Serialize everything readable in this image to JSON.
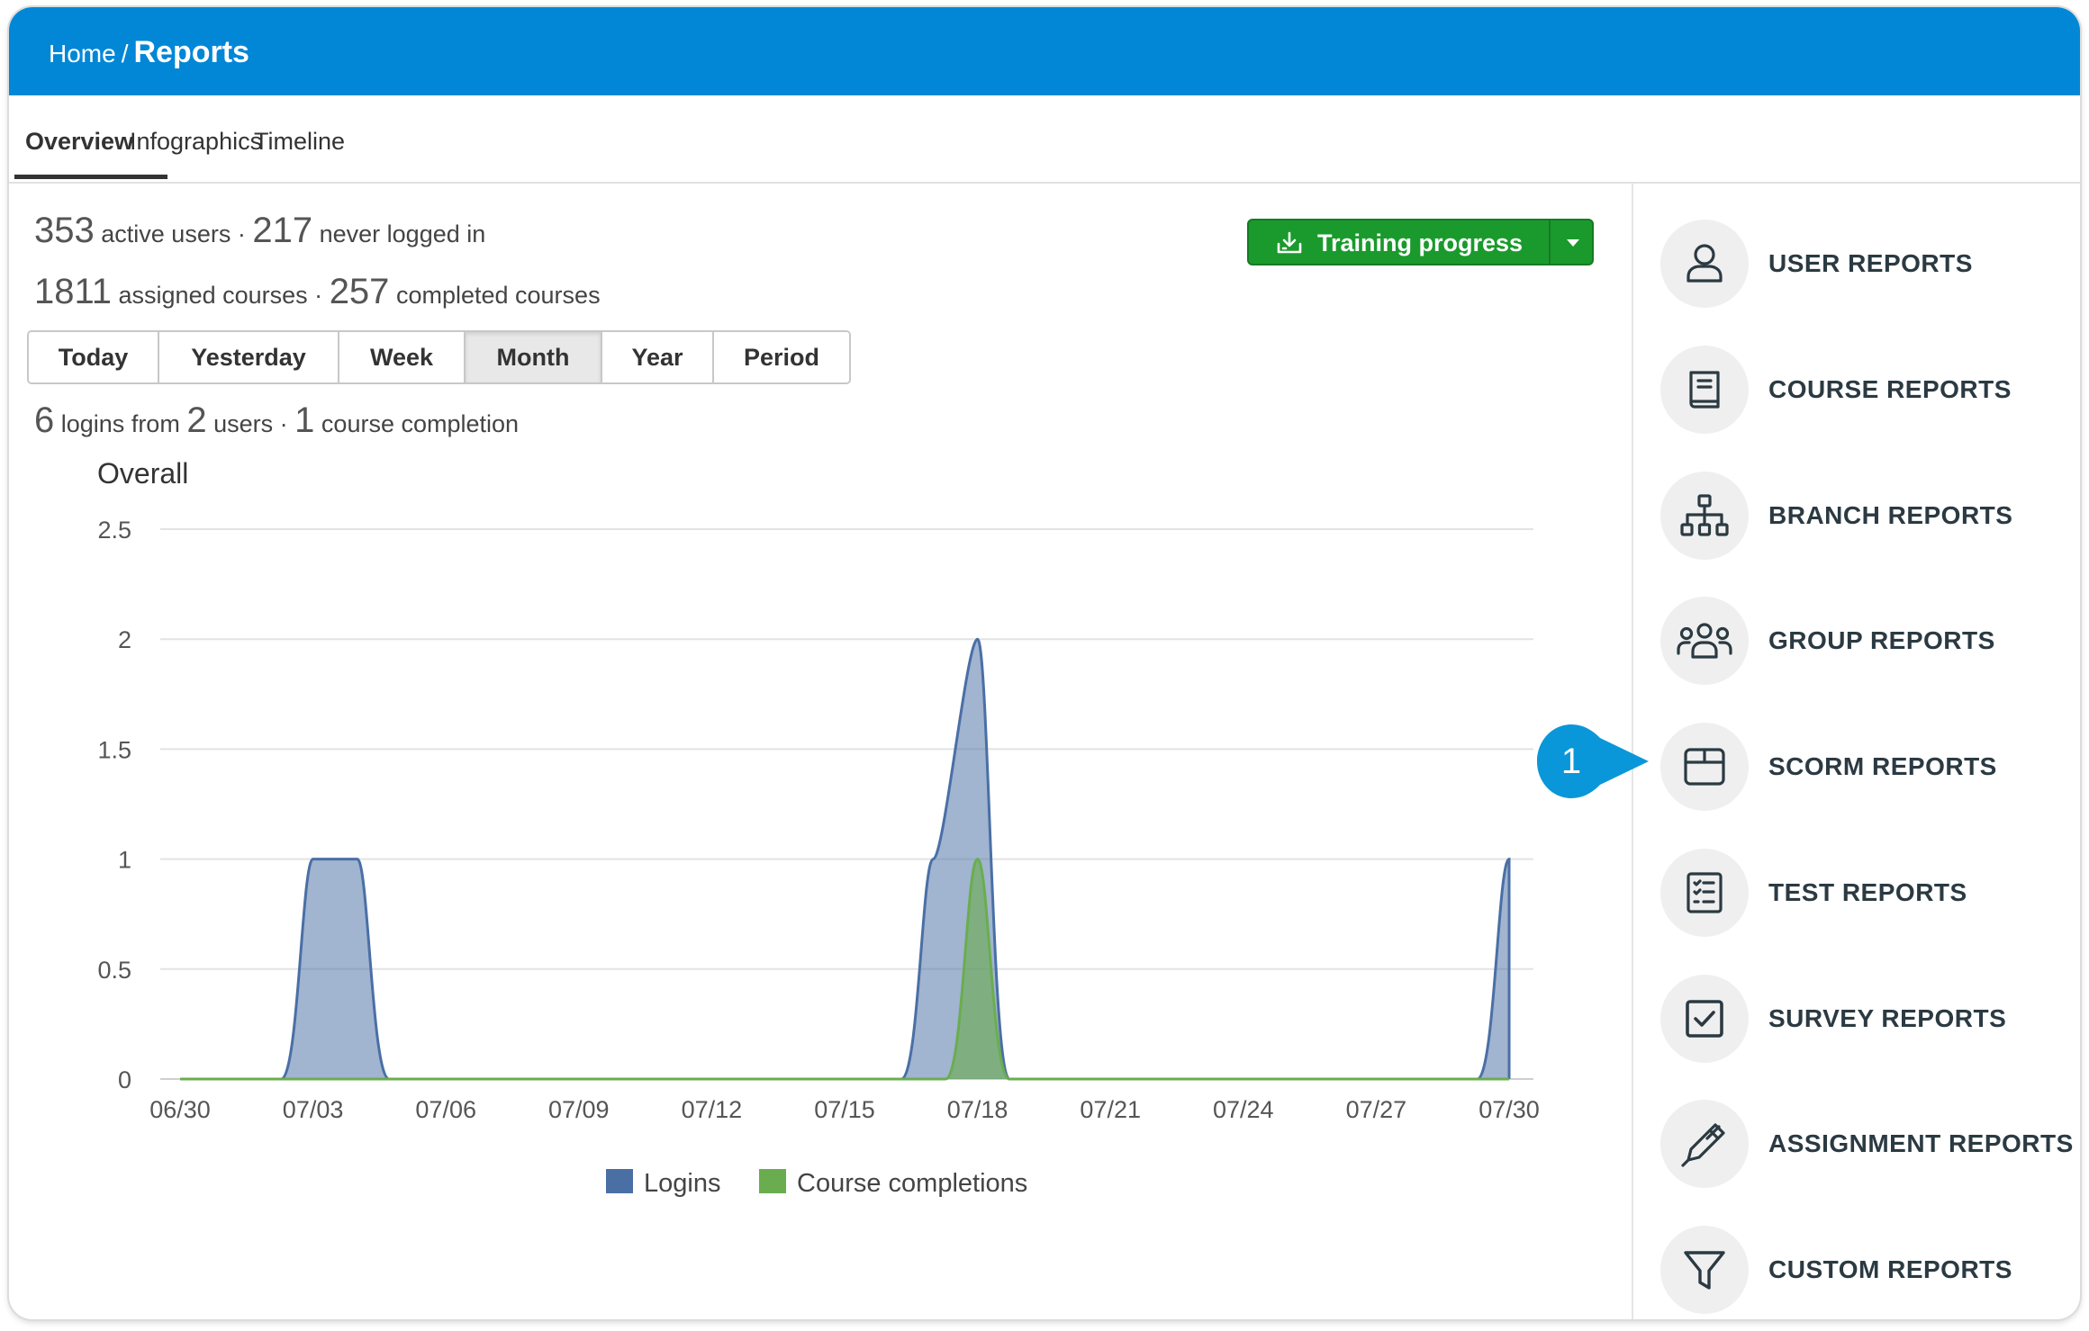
{
  "breadcrumb": {
    "home": "Home",
    "separator": "/",
    "current": "Reports"
  },
  "tabs": [
    {
      "label": "Overview",
      "active": true
    },
    {
      "label": "Infographics",
      "active": false
    },
    {
      "label": "Timeline",
      "active": false
    }
  ],
  "stats": {
    "active_users": "353",
    "active_users_label": "active users",
    "never_logged": "217",
    "never_logged_label": "never logged in",
    "assigned": "1811",
    "assigned_label": "assigned courses",
    "completed": "257",
    "completed_label": "completed courses",
    "dot": "·"
  },
  "training_button": {
    "label": "Training progress",
    "icon": "download-icon"
  },
  "period_buttons": [
    {
      "label": "Today",
      "active": false
    },
    {
      "label": "Yesterday",
      "active": false
    },
    {
      "label": "Week",
      "active": false
    },
    {
      "label": "Month",
      "active": true
    },
    {
      "label": "Year",
      "active": false
    },
    {
      "label": "Period",
      "active": false
    }
  ],
  "summary": {
    "logins": "6",
    "logins_label": "logins from",
    "users": "2",
    "users_label": "users",
    "completions": "1",
    "completions_label": "course completion",
    "dot": "·"
  },
  "chart_title": "Overall",
  "chart_data": {
    "type": "area",
    "title": "Overall",
    "x": [
      "06/30",
      "07/01",
      "07/02",
      "07/03",
      "07/04",
      "07/05",
      "07/06",
      "07/07",
      "07/08",
      "07/09",
      "07/10",
      "07/11",
      "07/12",
      "07/13",
      "07/14",
      "07/15",
      "07/16",
      "07/17",
      "07/18",
      "07/19",
      "07/20",
      "07/21",
      "07/22",
      "07/23",
      "07/24",
      "07/25",
      "07/26",
      "07/27",
      "07/28",
      "07/29",
      "07/30"
    ],
    "x_tick_labels": [
      "06/30",
      "07/03",
      "07/06",
      "07/09",
      "07/12",
      "07/15",
      "07/18",
      "07/21",
      "07/24",
      "07/27",
      "07/30"
    ],
    "y_tick_labels": [
      "0",
      "0.5",
      "1",
      "1.5",
      "2",
      "2.5"
    ],
    "ylim": [
      0,
      2.5
    ],
    "series": [
      {
        "name": "Logins",
        "color": "#4a6fa5",
        "values": [
          0,
          0,
          0,
          1,
          1,
          0,
          0,
          0,
          0,
          0,
          0,
          0,
          0,
          0,
          0,
          0,
          0,
          1,
          2,
          0,
          0,
          0,
          0,
          0,
          0,
          0,
          0,
          0,
          0,
          0,
          1
        ]
      },
      {
        "name": "Course completions",
        "color": "#6aad4f",
        "values": [
          0,
          0,
          0,
          0,
          0,
          0,
          0,
          0,
          0,
          0,
          0,
          0,
          0,
          0,
          0,
          0,
          0,
          0,
          1,
          0,
          0,
          0,
          0,
          0,
          0,
          0,
          0,
          0,
          0,
          0,
          0
        ]
      }
    ],
    "legend_position": "bottom-center",
    "grid": true
  },
  "report_links": [
    {
      "label": "USER REPORTS",
      "icon": "user-icon"
    },
    {
      "label": "COURSE REPORTS",
      "icon": "book-icon"
    },
    {
      "label": "BRANCH REPORTS",
      "icon": "sitemap-icon"
    },
    {
      "label": "GROUP REPORTS",
      "icon": "group-icon"
    },
    {
      "label": "SCORM REPORTS",
      "icon": "box-icon"
    },
    {
      "label": "TEST REPORTS",
      "icon": "checklist-icon"
    },
    {
      "label": "SURVEY REPORTS",
      "icon": "checkbox-icon"
    },
    {
      "label": "ASSIGNMENT REPORTS",
      "icon": "pen-icon"
    },
    {
      "label": "CUSTOM REPORTS",
      "icon": "filter-icon"
    }
  ],
  "callout": {
    "number": "1",
    "color": "#0a97d9"
  },
  "colors": {
    "topbar": "#0287d7",
    "button_green": "#1a9a2c"
  }
}
